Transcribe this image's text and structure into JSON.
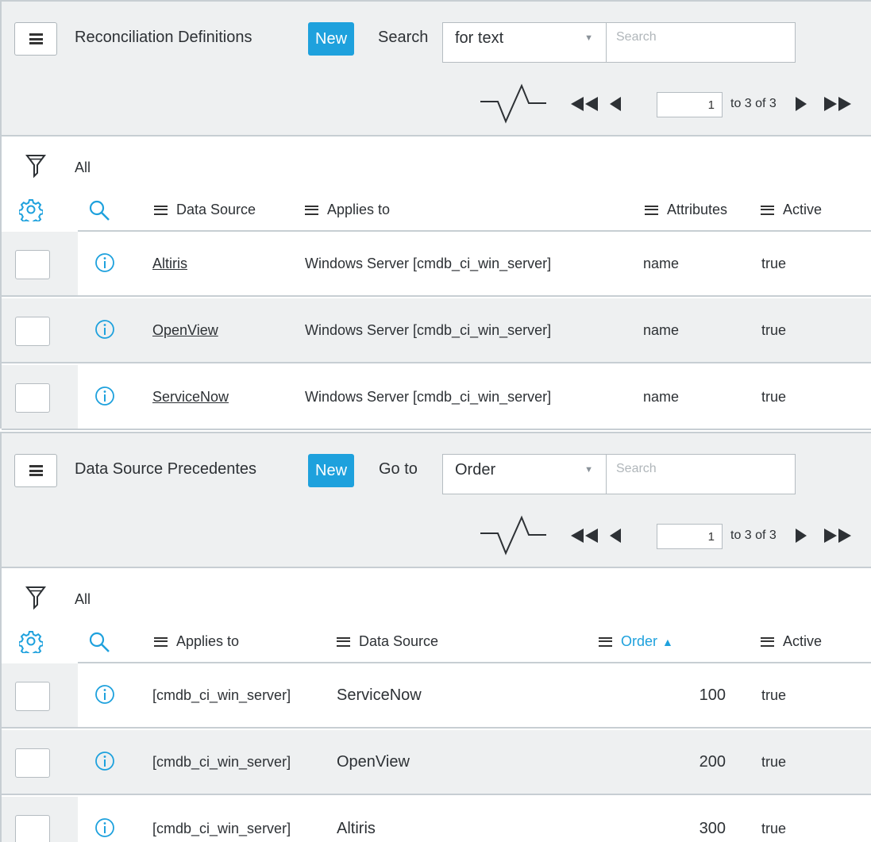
{
  "panels": [
    {
      "title": "Reconciliation Definitions",
      "new_label": "New",
      "search_label": "Search",
      "select_value": "for text",
      "search_placeholder": "Search",
      "page_value": "1",
      "page_count": "to 3 of 3",
      "filter_label": "All",
      "columns": [
        "Data Source",
        "Applies to",
        "Attributes",
        "Active"
      ],
      "rows": [
        [
          "Altiris",
          "Windows Server [cmdb_ci_win_server]",
          "name",
          "true"
        ],
        [
          "OpenView",
          "Windows Server [cmdb_ci_win_server]",
          "name",
          "true"
        ],
        [
          "ServiceNow",
          "Windows Server [cmdb_ci_win_server]",
          "name",
          "true"
        ]
      ]
    },
    {
      "title": "Data Source Precedentes",
      "new_label": "New",
      "search_label": "Go to",
      "select_value": "Order",
      "search_placeholder": "Search",
      "page_value": "1",
      "page_count": "to 3 of 3",
      "filter_label": "All",
      "columns": [
        "Applies to",
        "Data Source",
        "Order",
        "Active"
      ],
      "sorted_column": "Order",
      "sort_direction": "ascending",
      "rows": [
        [
          "[cmdb_ci_win_server]",
          "ServiceNow",
          "100",
          "true"
        ],
        [
          "[cmdb_ci_win_server]",
          "OpenView",
          "200",
          "true"
        ],
        [
          "[cmdb_ci_win_server]",
          "Altiris",
          "300",
          "true"
        ]
      ]
    }
  ],
  "icons": {
    "list-menu": "hamburger-icon",
    "activity": "pulse-icon",
    "filter": "funnel-icon",
    "personalize": "gear-icon",
    "column-search": "magnifier-icon",
    "row-preview": "info-icon"
  },
  "colors": {
    "accent": "#1ea1dd",
    "header_bg": "#eef0f1",
    "border": "#c7ced3"
  }
}
